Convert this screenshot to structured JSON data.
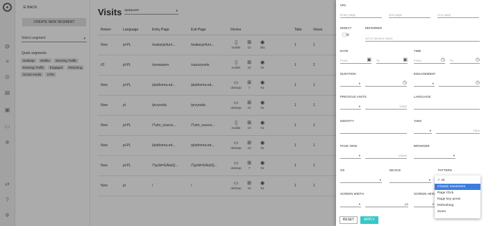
{
  "sidebar": {
    "back_label": "BACK",
    "create_label": "CREATE NEW SEGMENT",
    "segment_placeholder": "Select segment",
    "quick_label": "Quick segments",
    "chips": [
      "Desktop",
      "Mobile",
      "Morning Traffic",
      "Evening Traffic",
      "Engaged",
      "Returning",
      "Social media",
      "UTM"
    ]
  },
  "main": {
    "title": "Visits",
    "site": "apaquare",
    "columns": [
      "Return",
      "Language",
      "Entry Page",
      "Exit Page",
      "Device",
      "Tabs",
      "Views"
    ],
    "rows": [
      {
        "ret": "New",
        "lang": "pl-PL",
        "entry": "/wakacje/turn...",
        "exit": "/wakacje/turn...",
        "type": "mobile",
        "os": "10",
        "browser": "281",
        "tabs": "1",
        "views": "1"
      },
      {
        "ret": "#2",
        "lang": "pl-PL",
        "entry": "/serwaxem",
        "exit": "/sauszynele",
        "type": "mobile",
        "os": "10",
        "browser": "91",
        "tabs": "1",
        "views": "2"
      },
      {
        "ret": "New",
        "lang": "pl-PL",
        "entry": "/platforma-ed...",
        "exit": "/platforma-ed...",
        "type": "desktop",
        "os": "7",
        "browser": "91",
        "tabs": "1",
        "views": "1"
      },
      {
        "ret": "New",
        "lang": "pl",
        "entry": "/przyroda",
        "exit": "/przyroda",
        "type": "desktop",
        "os": "10",
        "browser": "91",
        "tabs": "1",
        "views": "1"
      },
      {
        "ret": "New",
        "lang": "pl-PL",
        "entry": "/?utm_source...",
        "exit": "/?utm_source...",
        "type": "mobile",
        "os": "10",
        "browser": "91",
        "tabs": "1",
        "views": "1"
      },
      {
        "ret": "New",
        "lang": "pl-PL",
        "entry": "/platforma-ed...",
        "exit": "/platforma-ed...",
        "type": "desktop",
        "os": "10",
        "browser": "91",
        "tabs": "1",
        "views": "1"
      },
      {
        "ret": "New",
        "lang": "pl-PL",
        "entry": "/?gclid=EAIaIQ...",
        "exit": "/?gclid=EAIaIQ...",
        "type": "desktop",
        "os": "7",
        "browser": "91",
        "tabs": "1",
        "views": "1"
      },
      {
        "ret": "New",
        "lang": "pl",
        "entry": "/",
        "exit": "/",
        "type": "desktop",
        "os": "10",
        "browser": "91",
        "tabs": "1",
        "views": "1"
      }
    ]
  },
  "filters": {
    "url_label": "URL",
    "entry_ph": "Entry page",
    "exit_ph": "Exit page",
    "any_ph": "Any page",
    "direct_label": "DIRECT",
    "referrer_label": "REFERRER",
    "referrer_ph": "Url or service name",
    "date_label": "DATE",
    "time_label": "TIME",
    "from": "From",
    "to": "To",
    "duration_label": "DURATION",
    "engagement_label": "ENGAGEMENT",
    "prev_visits_label": "PREVIOUS VISITS",
    "visits_ph": "Visits",
    "language_label": "LANGUAGE",
    "identity_label": "IDENTITY",
    "tabs_label": "TABS",
    "tabs_ph": "Tabs",
    "pageview_label": "PAGE VIEW",
    "views_ph": "Views",
    "browser_label": "BROWSER",
    "os_label": "OS",
    "device_label": "DEVICE",
    "pattern_label": "PATTERN",
    "screen_width_label": "SCREEN WIDTH",
    "screen_height_label": "SCREEN HEIGH",
    "px": "px",
    "reset_label": "RESET",
    "apply_label": "APPLY"
  },
  "pattern_options": [
    "All",
    "Chaotic movement",
    "Rage Click",
    "Rage key press",
    "Refreshing",
    "Zoom"
  ],
  "colors": {
    "accent": "#34c8c8",
    "selection": "#3c7ee0"
  }
}
